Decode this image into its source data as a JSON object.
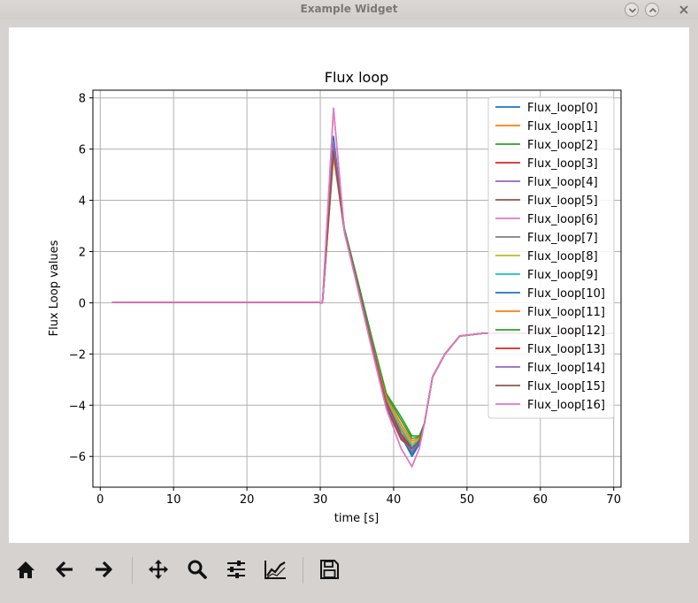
{
  "window": {
    "title": "Example Widget"
  },
  "toolbar": {
    "items": [
      "home-icon",
      "back-icon",
      "forward-icon",
      "pan-icon",
      "zoom-icon",
      "configure-subplots-icon",
      "edit-axis-icon",
      "save-icon"
    ]
  },
  "chart_data": {
    "type": "line",
    "title": "Flux loop",
    "xlabel": "time [s]",
    "ylabel": "Flux Loop values",
    "xlim": [
      -1,
      71
    ],
    "ylim": [
      -7.2,
      8.3
    ],
    "xticks": [
      0,
      10,
      20,
      30,
      40,
      50,
      60,
      70
    ],
    "yticks": [
      -6,
      -4,
      -2,
      0,
      2,
      4,
      6,
      8
    ],
    "grid": true,
    "legend_position": "top-right",
    "x": [
      1.6,
      10,
      20,
      29.4,
      30.3,
      31.8,
      33.3,
      35,
      37,
      39,
      41,
      42.5,
      43.5,
      44.2,
      45.3,
      47,
      49,
      52,
      55,
      60,
      65,
      70
    ],
    "base_values": [
      0.02,
      0.02,
      0.02,
      0.02,
      0.0,
      6.2,
      2.8,
      0.8,
      -1.6,
      -3.9,
      -5.1,
      -5.7,
      -5.4,
      -4.7,
      -2.9,
      -2.0,
      -1.3,
      -1.2,
      -1.2,
      -1.2,
      -1.2,
      -1.2
    ],
    "series": [
      {
        "name": "Flux_loop[0]",
        "color": "#1f77b4",
        "peak_offset": 0.0,
        "spread": 0.0,
        "min_offset": -0.2
      },
      {
        "name": "Flux_loop[1]",
        "color": "#ff7f0e",
        "peak_offset": -0.1,
        "spread": 0.05,
        "min_offset": 0.0
      },
      {
        "name": "Flux_loop[2]",
        "color": "#2ca02c",
        "peak_offset": -0.3,
        "spread": 0.12,
        "min_offset": 0.4
      },
      {
        "name": "Flux_loop[3]",
        "color": "#d62728",
        "peak_offset": -0.2,
        "spread": -0.05,
        "min_offset": 0.1
      },
      {
        "name": "Flux_loop[4]",
        "color": "#9467bd",
        "peak_offset": 0.1,
        "spread": 0.02,
        "min_offset": 0.2
      },
      {
        "name": "Flux_loop[5]",
        "color": "#8c564b",
        "peak_offset": -0.4,
        "spread": -0.08,
        "min_offset": 0.0
      },
      {
        "name": "Flux_loop[6]",
        "color": "#e377c2",
        "peak_offset": 1.4,
        "spread": -0.1,
        "min_offset": -0.7
      },
      {
        "name": "Flux_loop[7]",
        "color": "#7f7f7f",
        "peak_offset": 0.2,
        "spread": 0.04,
        "min_offset": 0.1
      },
      {
        "name": "Flux_loop[8]",
        "color": "#bcbd22",
        "peak_offset": 0.0,
        "spread": 0.06,
        "min_offset": 0.2
      },
      {
        "name": "Flux_loop[9]",
        "color": "#17becf",
        "peak_offset": -0.1,
        "spread": 0.03,
        "min_offset": 0.1
      },
      {
        "name": "Flux_loop[10]",
        "color": "#1f77b4",
        "peak_offset": 0.3,
        "spread": 0.01,
        "min_offset": -0.3
      },
      {
        "name": "Flux_loop[11]",
        "color": "#ff7f0e",
        "peak_offset": -0.5,
        "spread": 0.08,
        "min_offset": 0.3
      },
      {
        "name": "Flux_loop[12]",
        "color": "#2ca02c",
        "peak_offset": 0.0,
        "spread": 0.15,
        "min_offset": 0.5
      },
      {
        "name": "Flux_loop[13]",
        "color": "#d62728",
        "peak_offset": -0.2,
        "spread": 0.0,
        "min_offset": 0.0
      },
      {
        "name": "Flux_loop[14]",
        "color": "#9467bd",
        "peak_offset": 0.1,
        "spread": -0.03,
        "min_offset": -0.1
      },
      {
        "name": "Flux_loop[15]",
        "color": "#8c564b",
        "peak_offset": -0.3,
        "spread": -0.06,
        "min_offset": 0.0
      },
      {
        "name": "Flux_loop[16]",
        "color": "#e377c2",
        "peak_offset": 1.4,
        "spread": -0.1,
        "min_offset": -0.7
      }
    ]
  }
}
